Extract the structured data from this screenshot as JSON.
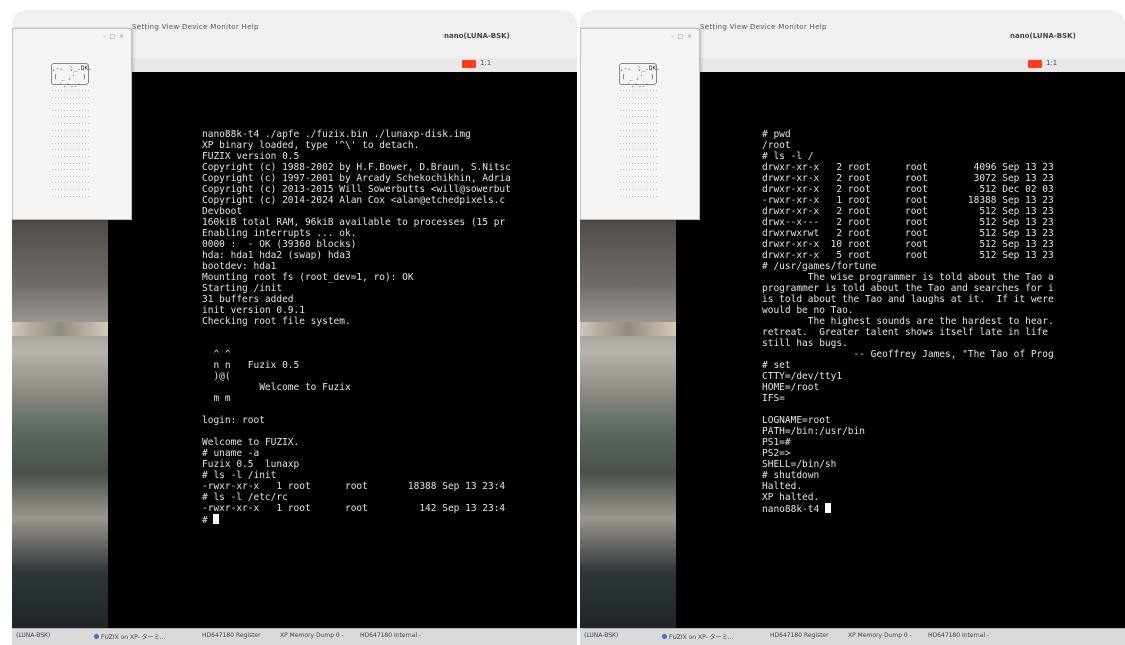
{
  "left": {
    "window_title": "nano(LUNA-BSK)",
    "menu": "Setting   View   Device   Monitor   Help",
    "toolbar_label": "1:1",
    "dialog_widget": ",-.  ;_.DK.\n( _ ,'  )\n`-'--'",
    "terminal": {
      "lines": [
        "nano88k-t4 ./apfe ./fuzix.bin ./lunaxp-disk.img",
        "XP binary loaded, type '^\\' to detach.",
        "FUZIX version 0.5",
        "Copyright (c) 1988-2002 by H.F.Bower, D.Braun, S.Nitsc",
        "Copyright (c) 1997-2001 by Arcady Schekochikhin, Adria",
        "Copyright (c) 2013-2015 Will Sowerbutts <will@sowerbut",
        "Copyright (c) 2014-2024 Alan Cox <alan@etchedpixels.c",
        "Devboot",
        "160kiB total RAM, 96kiB available to processes (15 pr",
        "Enabling interrupts ... ok.",
        "0000 :  - OK (39360 blocks)",
        "hda: hda1 hda2 (swap) hda3",
        "bootdev: hda1",
        "Mounting root fs (root_dev=1, ro): OK",
        "Starting /init",
        "31 buffers added",
        "init version 0.9.1",
        "Checking root file system.",
        "",
        "",
        "  ^ ^",
        "  n n   Fuzix 0.5",
        "  )@(",
        "          Welcome to Fuzix",
        "  m m",
        "",
        "login: root",
        "",
        "Welcome to FUZIX.",
        "# uname -a",
        "Fuzix 0.5  lunaxp",
        "# ls -l /init",
        "-rwxr-xr-x   1 root      root       18388 Sep 13 23:4",
        "# ls -l /etc/rc",
        "-rwxr-xr-x   1 root      root         142 Sep 13 23:4",
        "# "
      ]
    },
    "taskbar": [
      "(LUNA-BSK)",
      "FUZIX on XP- ターミ...",
      "HD647180 Register",
      "XP Memory Dump 0 -",
      "HD647180 Internal -"
    ]
  },
  "right": {
    "window_title": "nano(LUNA-BSK)",
    "menu": "Setting   View   Device   Monitor   Help",
    "toolbar_label": "1:1",
    "dialog_widget": ",-.  ;_.DK.\n( _ ,'  )\n`-'--'",
    "terminal": {
      "lines": [
        "# pwd",
        "/root",
        "# ls -l /",
        "drwxr-xr-x   2 root      root        4096 Sep 13 23",
        "drwxr-xr-x   2 root      root        3072 Sep 13 23",
        "drwxr-xr-x   2 root      root         512 Dec 02 03",
        "-rwxr-xr-x   1 root      root       18388 Sep 13 23",
        "drwxr-xr-x   2 root      root         512 Sep 13 23",
        "drwx--x---   2 root      root         512 Sep 13 23",
        "drwxrwxrwt   2 root      root         512 Sep 13 23",
        "drwxr-xr-x  10 root      root         512 Sep 13 23",
        "drwxr-xr-x   5 root      root         512 Sep 13 23",
        "# /usr/games/fortune",
        "        The wise programmer is told about the Tao a",
        "programmer is told about the Tao and searches for i",
        "is told about the Tao and laughs at it.  If it were",
        "would be no Tao.",
        "        The highest sounds are the hardest to hear.",
        "retreat.  Greater talent shows itself late in life",
        "still has bugs.",
        "                -- Geoffrey James, \"The Tao of Prog",
        "# set",
        "CTTY=/dev/tty1",
        "HOME=/root",
        "IFS=",
        "",
        "LOGNAME=root",
        "PATH=/bin:/usr/bin",
        "PS1=#",
        "PS2=>",
        "SHELL=/bin/sh",
        "# shutdown",
        "Halted.",
        "XP halted.",
        "nano88k-t4 "
      ]
    },
    "taskbar": [
      "(LUNA-BSK)",
      "FUZIX on XP- ターミ...",
      "HD647180 Register",
      "XP Memory Dump 0 -",
      "HD647180 Internal -"
    ]
  },
  "colors": {
    "terminal_bg": "#000000",
    "terminal_fg": "#e4e4e4",
    "record_red": "#ff3b1f"
  }
}
